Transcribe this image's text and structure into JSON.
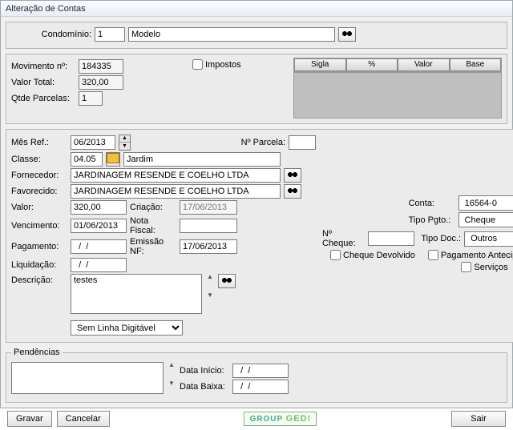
{
  "title": "Alteração de Contas",
  "condominio": {
    "label": "Condomínio:",
    "num": "1",
    "name": "Modelo"
  },
  "topright_tabs": [
    "Sigla",
    "%",
    "Valor",
    "Base"
  ],
  "summary": {
    "movimento_label": "Movimento nº:",
    "movimento": "184335",
    "valortotal_label": "Valor Total:",
    "valortotal": "320,00",
    "qtdeparcelas_label": "Qtde Parcelas:",
    "qtdeparcelas": "1",
    "impostos_label": "Impostos"
  },
  "main": {
    "mesref_label": "Mês Ref.:",
    "mesref": "06/2013",
    "nparcela_label": "Nº Parcela:",
    "nparcela": "",
    "classe_label": "Classe:",
    "classe_code": "04.05",
    "classe_name": "Jardim",
    "fornecedor_label": "Fornecedor:",
    "fornecedor": "JARDINAGEM RESENDE E COELHO LTDA",
    "favorecido_label": "Favorecido:",
    "favorecido": "JARDINAGEM RESENDE E COELHO LTDA",
    "valor_label": "Valor:",
    "valor": "320,00",
    "criacao_label": "Criação:",
    "criacao": "17/06/2013",
    "vencimento_label": "Vencimento:",
    "vencimento": "01/06/2013",
    "notafiscal_label": "Nota Fiscal:",
    "notafiscal": "",
    "pagamento_label": "Pagamento:",
    "pagamento": "  /  /",
    "emissaonf_label": "Emissão NF:",
    "emissaonf": "17/06/2013",
    "liquidacao_label": "Liquidação:",
    "liquidacao": "  /  /",
    "descricao_label": "Descrição:",
    "descricao": "testes",
    "ncheque_label": "Nº Cheque:",
    "ncheque": "",
    "conta_label": "Conta:",
    "conta": "16564-0",
    "tipopgto_label": "Tipo Pgto.:",
    "tipopgto": "Cheque",
    "tipodoc_label": "Tipo Doc.:",
    "tipodoc": "Outros",
    "chk_chequedev": "Cheque Devolvido",
    "chk_pagantecip": "Pagamento Antecipado",
    "chk_servicos": "Serviços",
    "linha_digitavel": "Sem Linha Digitável"
  },
  "pendencias": {
    "legend": "Pendências",
    "datainicio_label": "Data Início:",
    "datainicio": "  /  /",
    "databaixa_label": "Data Baixa:",
    "databaixa": "  /  /"
  },
  "buttons": {
    "gravar": "Gravar",
    "cancelar": "Cancelar",
    "sair": "Sair",
    "groupged": "GROUP GED!"
  }
}
